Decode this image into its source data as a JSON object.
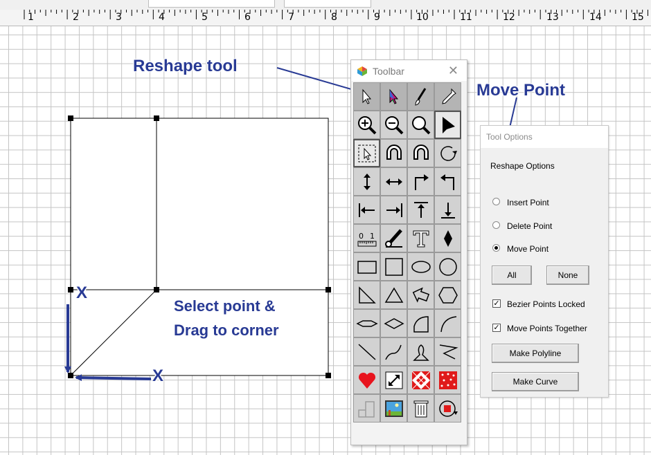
{
  "ruler": {
    "numbers": [
      "1",
      "2",
      "3",
      "4",
      "5",
      "6",
      "7",
      "8",
      "9",
      "10",
      "11",
      "12",
      "13",
      "14",
      "15"
    ]
  },
  "annotations": {
    "reshape_tool": "Reshape tool",
    "move_point": "Move Point",
    "select_line1": "Select point &",
    "select_line2": "Drag to corner",
    "x_mark_top": "X",
    "x_mark_bottom": "X"
  },
  "colors": {
    "annotation": "#283a94",
    "grid": "#c4c4c4",
    "heart": "#e8141e",
    "quilt_red": "#e01a1a"
  },
  "toolbar": {
    "title": "Toolbar",
    "close_glyph": "✕",
    "tools": [
      "arrow-select-icon",
      "color-select-icon",
      "brush-icon",
      "eyedropper-icon",
      "zoom-in-icon",
      "zoom-out-icon",
      "zoom-fit-icon",
      "reshape-arrow-icon",
      "select-box-icon",
      "magnet-icon",
      "magnet-2-icon",
      "rotate-icon",
      "flip-vertical-icon",
      "flip-horizontal-icon",
      "corner-right-icon",
      "corner-left-icon",
      "align-left-icon",
      "align-right-icon",
      "align-top-icon",
      "align-bottom-icon",
      "ruler-icon",
      "pen-icon",
      "text-icon",
      "diamond-icon",
      "rectangle-icon",
      "square-icon",
      "ellipse-icon",
      "circle-icon",
      "right-triangle-icon",
      "triangle-icon",
      "arrow-shape-icon",
      "hexagon-icon",
      "diamond-wide-icon",
      "rhombus-icon",
      "half-arc-icon",
      "arc-icon",
      "line-icon",
      "curve-icon",
      "loop-icon",
      "zigzag-icon",
      "heart-icon",
      "resize-icon",
      "quilt-block-icon",
      "dots-fabric-icon",
      "corner-block-icon",
      "picture-icon",
      "trash-icon",
      "rotate-block-icon"
    ]
  },
  "tool_options": {
    "title": "Tool Options",
    "section": "Reshape Options",
    "radios": [
      {
        "label": "Insert Point",
        "checked": false
      },
      {
        "label": "Delete Point",
        "checked": false
      },
      {
        "label": "Move Point",
        "checked": true
      }
    ],
    "all_button": "All",
    "none_button": "None",
    "checkboxes": [
      {
        "label": "Bezier Points Locked",
        "checked": true
      },
      {
        "label": "Move Points Together",
        "checked": true
      }
    ],
    "make_polyline": "Make Polyline",
    "make_curve": "Make Curve"
  }
}
